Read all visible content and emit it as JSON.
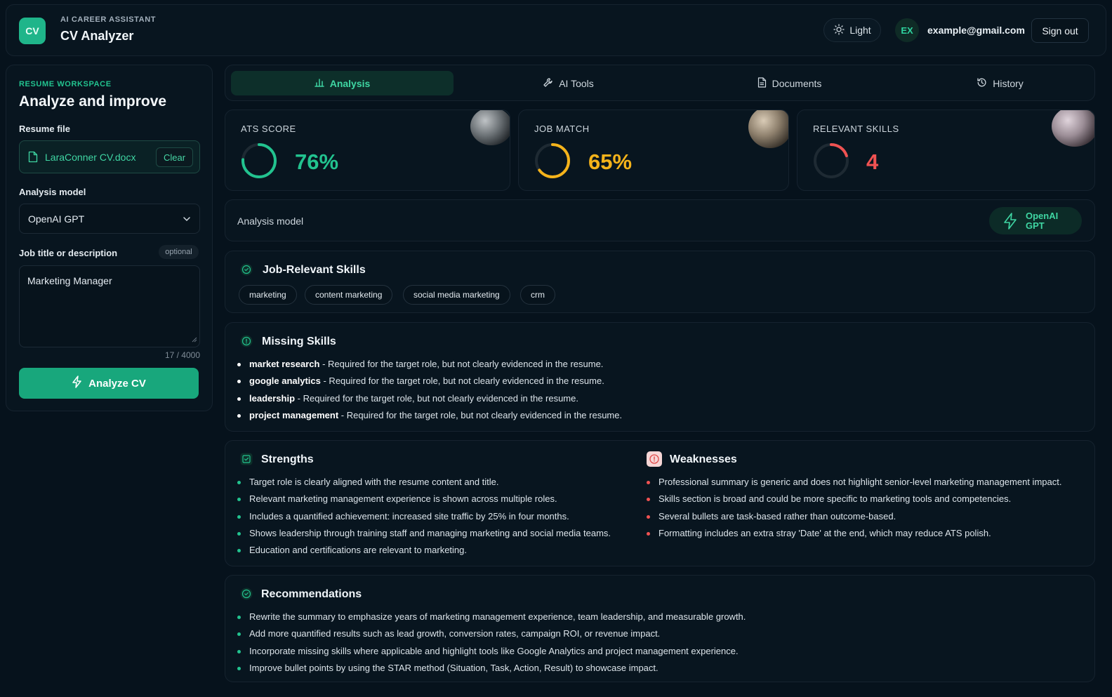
{
  "header": {
    "logo_text": "CV",
    "kicker": "AI CAREER ASSISTANT",
    "title": "CV Analyzer",
    "theme_label": "Light",
    "avatar_initials": "EX",
    "email": "example@gmail.com",
    "signout_label": "Sign out"
  },
  "sidebar": {
    "kicker": "RESUME WORKSPACE",
    "title": "Analyze and improve",
    "resume_label": "Resume file",
    "file_name": "LaraConner CV.docx",
    "clear_label": "Clear",
    "model_label": "Analysis model",
    "model_value": "OpenAI GPT",
    "job_label": "Job title or description",
    "optional_label": "optional",
    "job_value": "Marketing Manager",
    "char_count": "17 / 4000",
    "analyze_label": "Analyze CV"
  },
  "tabs": [
    {
      "label": "Analysis",
      "icon": "bar-chart-icon",
      "active": true
    },
    {
      "label": "AI Tools",
      "icon": "wrench-icon",
      "active": false
    },
    {
      "label": "Documents",
      "icon": "document-icon",
      "active": false
    },
    {
      "label": "History",
      "icon": "history-icon",
      "active": false
    }
  ],
  "stats": {
    "ats": {
      "label": "ATS SCORE",
      "value": "76%",
      "fraction": 0.76,
      "color": "#22c38f"
    },
    "match": {
      "label": "JOB MATCH",
      "value": "65%",
      "fraction": 0.65,
      "color": "#f5b31a"
    },
    "skills": {
      "label": "RELEVANT SKILLS",
      "value": "4",
      "fraction": 0.2,
      "color": "#f05252"
    }
  },
  "model_row": {
    "label": "Analysis model",
    "pill": "OpenAI GPT"
  },
  "relevant_skills": {
    "title": "Job-Relevant Skills",
    "chips": [
      "marketing",
      "content marketing",
      "social media marketing",
      "crm"
    ]
  },
  "missing_skills": {
    "title": "Missing Skills",
    "items": [
      {
        "skill": "market research",
        "note": " - Required for the target role, but not clearly evidenced in the resume."
      },
      {
        "skill": "google analytics",
        "note": " - Required for the target role, but not clearly evidenced in the resume."
      },
      {
        "skill": "leadership",
        "note": " - Required for the target role, but not clearly evidenced in the resume."
      },
      {
        "skill": "project management",
        "note": " - Required for the target role, but not clearly evidenced in the resume."
      }
    ]
  },
  "strengths": {
    "title": "Strengths",
    "items": [
      "Target role is clearly aligned with the resume content and title.",
      "Relevant marketing management experience is shown across multiple roles.",
      "Includes a quantified achievement: increased site traffic by 25% in four months.",
      "Shows leadership through training staff and managing marketing and social media teams.",
      "Education and certifications are relevant to marketing."
    ]
  },
  "weaknesses": {
    "title": "Weaknesses",
    "items": [
      "Professional summary is generic and does not highlight senior-level marketing management impact.",
      "Skills section is broad and could be more specific to marketing tools and competencies.",
      "Several bullets are task-based rather than outcome-based.",
      "Formatting includes an extra stray 'Date' at the end, which may reduce ATS polish."
    ]
  },
  "recommendations": {
    "title": "Recommendations",
    "items": [
      "Rewrite the summary to emphasize years of marketing management experience, team leadership, and measurable growth.",
      "Add more quantified results such as lead growth, conversion rates, campaign ROI, or revenue impact.",
      "Incorporate missing skills where applicable and highlight tools like Google Analytics and project management experience.",
      "Improve bullet points by using the STAR method (Situation, Task, Action, Result) to showcase impact."
    ]
  },
  "colors": {
    "accent": "#22c38f",
    "warning": "#f5b31a",
    "danger": "#f05252",
    "bg": "#06121c"
  }
}
